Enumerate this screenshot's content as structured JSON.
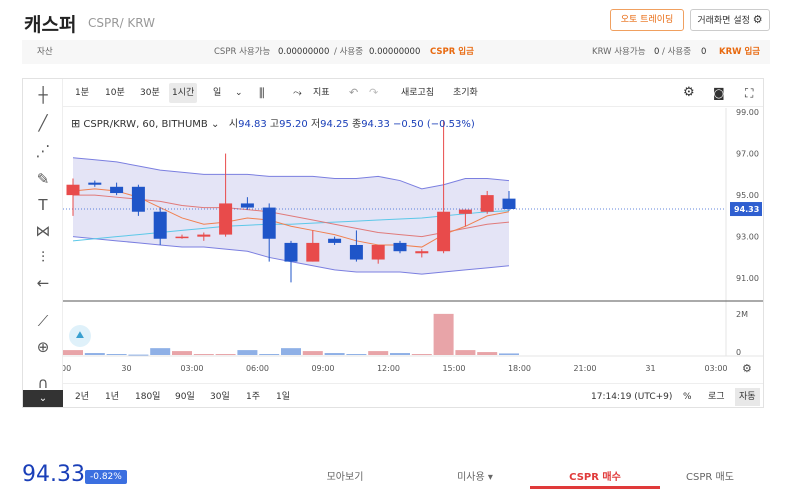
{
  "header": {
    "coin_name": "캐스퍼",
    "pair": "CSPR/ KRW",
    "auto_trade_label": "오토 트레이딩",
    "layout_label": "거래화면 설정"
  },
  "assets": {
    "label": "자산",
    "cspr_available_label": "CSPR 사용가능",
    "cspr_available": "0.00000000",
    "cspr_inuse_label": "/ 사용중",
    "cspr_inuse": "0.00000000",
    "cspr_deposit": "CSPR 입금",
    "krw_available_label": "KRW 사용가능",
    "krw_available": "0",
    "krw_inuse_label": "/ 사용중",
    "krw_inuse": "0",
    "krw_deposit": "KRW 입금"
  },
  "toolbar": {
    "intervals": [
      "1분",
      "10분",
      "30분",
      "1시간",
      "일"
    ],
    "active_interval": "1시간",
    "indicator_label": "지표",
    "refresh_label": "새로고침",
    "reset_label": "초기화"
  },
  "legend": {
    "symbol": "CSPR/KRW, 60, BITHUMB",
    "open_label": "시",
    "open": "94.83",
    "high_label": "고",
    "high": "95.20",
    "low_label": "저",
    "low": "94.25",
    "close_label": "종",
    "close": "94.33",
    "change": "−0.50 (−0.53%)"
  },
  "range_toolbar": {
    "ranges": [
      "2년",
      "1년",
      "180일",
      "90일",
      "30일",
      "1주",
      "1일"
    ],
    "clock": "17:14:19 (UTC+9)",
    "percent_label": "%",
    "log_label": "로그",
    "auto_label": "자동"
  },
  "chart_data": {
    "type": "candlestick",
    "x_ticks": [
      "00",
      "30",
      "03:00",
      "06:00",
      "09:00",
      "12:00",
      "15:00",
      "18:00",
      "21:00",
      "31",
      "03:00"
    ],
    "price_ticks": [
      "99.00",
      "97.00",
      "95.00",
      "93.00",
      "91.00"
    ],
    "ylim": [
      90.0,
      99.0
    ],
    "current_price": "94.33",
    "volume_ticks": [
      "2M",
      "0"
    ],
    "candles": [
      {
        "o": 95.0,
        "h": 95.8,
        "l": 94.0,
        "c": 95.5
      },
      {
        "o": 95.6,
        "h": 95.7,
        "l": 95.4,
        "c": 95.5
      },
      {
        "o": 95.4,
        "h": 95.6,
        "l": 95.0,
        "c": 95.1
      },
      {
        "o": 95.4,
        "h": 95.5,
        "l": 94.0,
        "c": 94.2
      },
      {
        "o": 94.2,
        "h": 94.4,
        "l": 92.6,
        "c": 92.9
      },
      {
        "o": 93.0,
        "h": 93.1,
        "l": 92.9,
        "c": 93.0
      },
      {
        "o": 93.0,
        "h": 93.2,
        "l": 92.8,
        "c": 93.1
      },
      {
        "o": 93.1,
        "h": 97.0,
        "l": 93.0,
        "c": 94.6
      },
      {
        "o": 94.6,
        "h": 94.9,
        "l": 94.3,
        "c": 94.4
      },
      {
        "o": 94.4,
        "h": 94.6,
        "l": 91.8,
        "c": 92.9
      },
      {
        "o": 92.7,
        "h": 92.8,
        "l": 90.8,
        "c": 91.8
      },
      {
        "o": 91.8,
        "h": 93.3,
        "l": 91.8,
        "c": 92.7
      },
      {
        "o": 92.9,
        "h": 93.0,
        "l": 92.6,
        "c": 92.7
      },
      {
        "o": 92.6,
        "h": 93.3,
        "l": 91.8,
        "c": 91.9
      },
      {
        "o": 91.9,
        "h": 92.6,
        "l": 91.7,
        "c": 92.6
      },
      {
        "o": 92.7,
        "h": 92.8,
        "l": 92.2,
        "c": 92.3
      },
      {
        "o": 92.2,
        "h": 92.4,
        "l": 92.0,
        "c": 92.3
      },
      {
        "o": 92.3,
        "h": 98.6,
        "l": 92.2,
        "c": 94.2
      },
      {
        "o": 94.1,
        "h": 94.3,
        "l": 93.5,
        "c": 94.3
      },
      {
        "o": 94.2,
        "h": 95.2,
        "l": 94.1,
        "c": 95.0
      },
      {
        "o": 94.83,
        "h": 95.2,
        "l": 94.25,
        "c": 94.33
      }
    ],
    "volumes": [
      0.25,
      0.1,
      0.05,
      0.02,
      0.35,
      0.2,
      0.05,
      0.05,
      0.25,
      0.05,
      0.35,
      0.2,
      0.1,
      0.05,
      0.2,
      0.1,
      0.05,
      2.1,
      0.25,
      0.15,
      0.08
    ],
    "bollinger_upper": [
      96.8,
      96.7,
      96.6,
      96.4,
      96.2,
      96.1,
      96.0,
      96.0,
      96.0,
      95.9,
      95.9,
      95.9,
      95.8,
      95.8,
      95.9,
      95.7,
      95.3,
      95.5,
      95.8,
      95.8,
      95.7
    ],
    "bollinger_lower": [
      93.0,
      92.9,
      92.8,
      92.7,
      92.6,
      92.5,
      92.5,
      92.4,
      92.3,
      92.0,
      91.8,
      91.6,
      91.4,
      91.3,
      91.3,
      91.3,
      91.2,
      91.3,
      91.4,
      91.5,
      91.6
    ],
    "ma_short": [
      95.2,
      95.3,
      95.2,
      94.9,
      94.4,
      93.9,
      93.6,
      93.7,
      93.9,
      93.8,
      93.5,
      93.3,
      93.1,
      92.8,
      92.6,
      92.6,
      92.5,
      93.1,
      93.5,
      94.0,
      94.2
    ],
    "ma_long": [
      95.0,
      95.0,
      94.9,
      94.8,
      94.7,
      94.5,
      94.4,
      94.4,
      94.3,
      94.2,
      94.0,
      93.8,
      93.6,
      93.4,
      93.2,
      93.1,
      93.0,
      93.2,
      93.4,
      93.6,
      93.7
    ],
    "ma_trend": [
      92.8,
      92.9,
      93.0,
      93.1,
      93.2,
      93.3,
      93.4,
      93.5,
      93.55,
      93.6,
      93.6,
      93.65,
      93.7,
      93.75,
      93.8,
      93.85,
      93.9,
      94.0,
      94.1,
      94.2,
      94.25
    ],
    "colors": {
      "up": "#e84b4b",
      "down": "#1f55c8",
      "band_fill": "#e4e4f6",
      "band_line": "#7b7fe0",
      "ma_short": "#f08050",
      "ma_long": "#e07a7a",
      "ma_trend": "#5cc8e8"
    }
  },
  "bottom": {
    "price": "94.33",
    "change_pct": "-0.82%",
    "tabs": [
      "모아보기",
      "미사용 ▾",
      "CSPR 매수",
      "CSPR 매도"
    ]
  }
}
